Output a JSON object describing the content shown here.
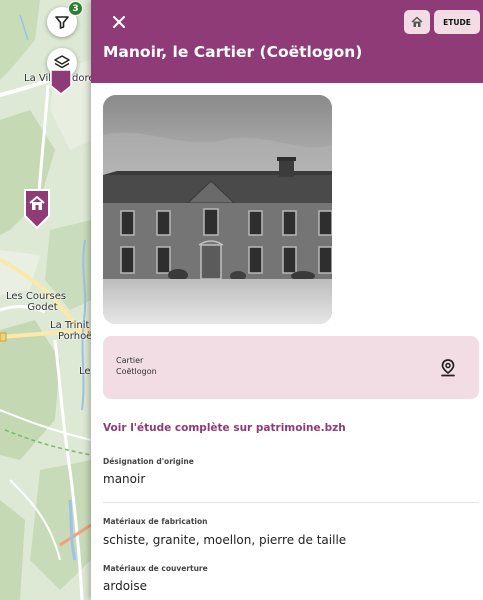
{
  "map": {
    "labels": {
      "village_top": "La Ville",
      "village_top_suffix": "dore",
      "courses_line1": "Les Courses",
      "courses_line2": "Godet",
      "trinite_line1": "La Trinit",
      "trinite_line2": "Porhoë",
      "le": "Le"
    },
    "filter_badge_count": "3",
    "icons": {
      "filter": "filter-icon",
      "layers": "layers-icon",
      "home_marker": "home-icon"
    }
  },
  "panel": {
    "title": "Manoir, le Cartier (Coëtlogon)",
    "chips": {
      "home_icon": "home-icon",
      "etude_label": "ETUDE"
    },
    "location": {
      "line1": "Cartier",
      "line2": "Coëtlogon",
      "icon": "map-pin-icon"
    },
    "study_link": "Voir l'étude complète sur patrimoine.bzh",
    "fields": [
      {
        "label": "Désignation d'origine",
        "value": "manoir"
      },
      {
        "label": "Matériaux de fabrication",
        "value": "schiste, granite, moellon, pierre de taille"
      },
      {
        "label": "Matériaux de couverture",
        "value": "ardoise"
      }
    ]
  },
  "colors": {
    "accent": "#8f3b77",
    "chip_bg": "#f2dde5",
    "badge": "#2f7d32"
  }
}
